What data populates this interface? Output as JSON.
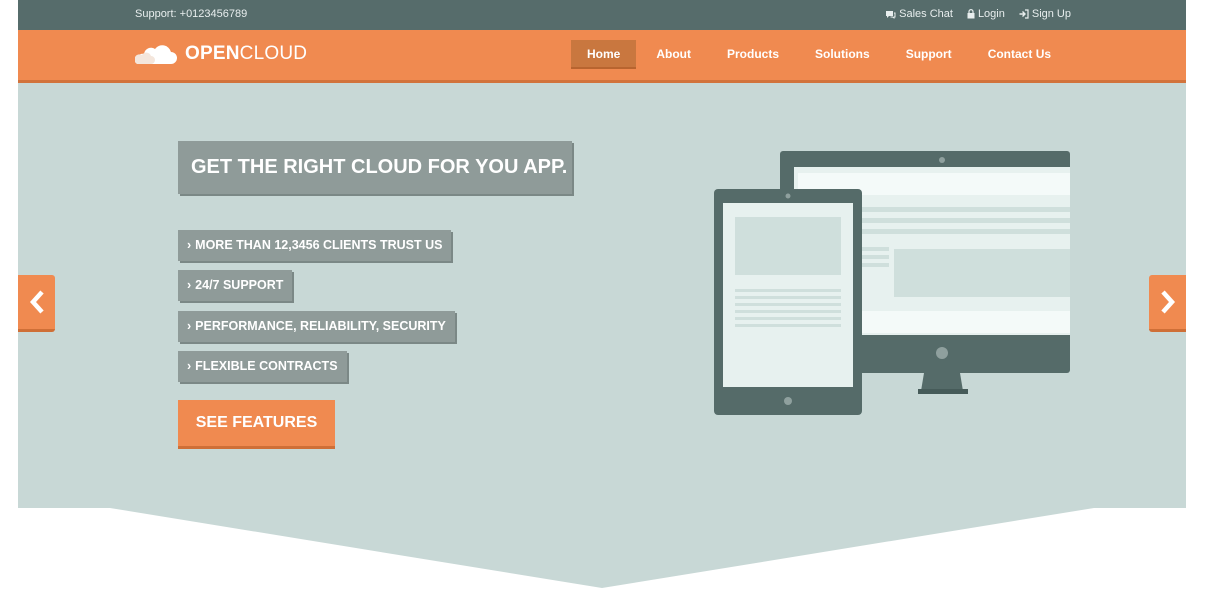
{
  "topbar": {
    "support": "Support: +0123456789",
    "links": [
      {
        "label": "Sales Chat",
        "icon": "chat-icon"
      },
      {
        "label": "Login",
        "icon": "lock-icon"
      },
      {
        "label": "Sign Up",
        "icon": "sign-in-icon"
      }
    ]
  },
  "brand": {
    "bold": "OPEN",
    "light": "CLOUD"
  },
  "nav": {
    "items": [
      "Home",
      "About",
      "Products",
      "Solutions",
      "Support",
      "Contact Us"
    ],
    "active": "Home"
  },
  "hero": {
    "headline": "GET THE RIGHT CLOUD FOR YOU APP.",
    "features": [
      "MORE THAN 12,3456 CLIENTS TRUST US",
      "24/7 SUPPORT",
      "PERFORMANCE, RELIABILITY, SECURITY",
      "FLEXIBLE CONTRACTS"
    ],
    "cta": "SEE FEATURES"
  },
  "colors": {
    "topbar": "#566c6b",
    "accent": "#f08a50",
    "hero": "#c8d8d6",
    "label_bg": "#8f9b99",
    "device": "#556b69"
  }
}
